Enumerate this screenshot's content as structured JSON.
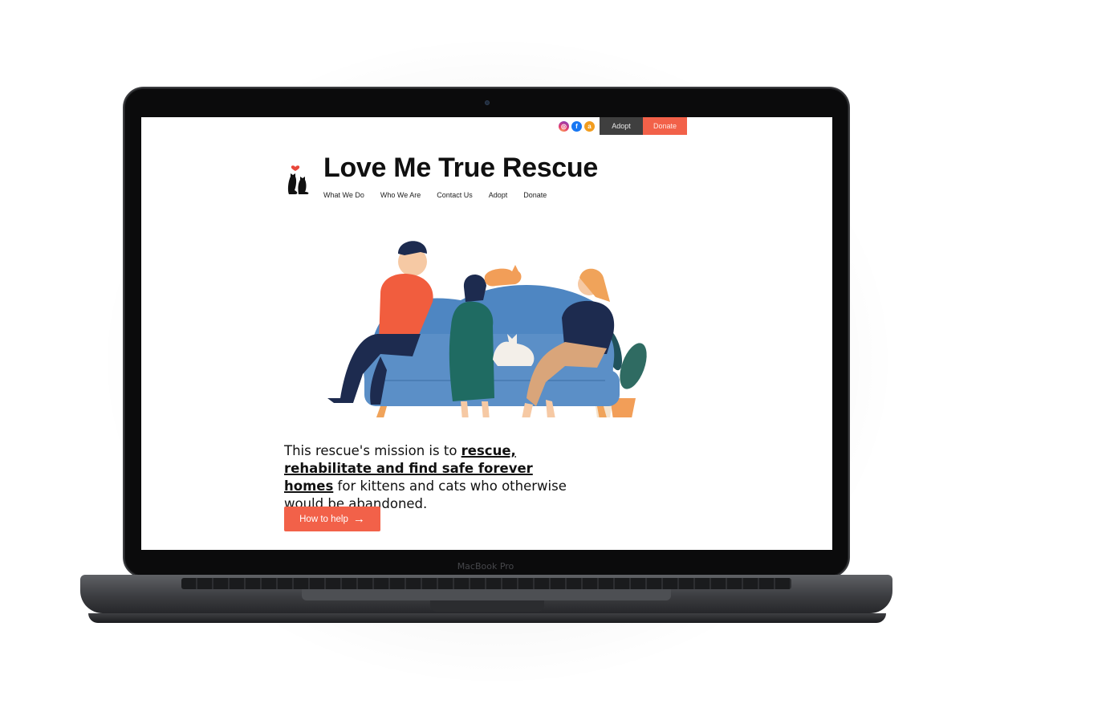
{
  "device": {
    "brand_label": "MacBook Pro"
  },
  "topbar": {
    "social_icons": [
      "instagram-icon",
      "facebook-icon",
      "amazon-icon"
    ],
    "adopt_label": "Adopt",
    "donate_label": "Donate"
  },
  "header": {
    "title": "Love Me True Rescue",
    "logo_icon": "cat-heart-logo",
    "nav": [
      "What We Do",
      "Who We Are",
      "Contact Us",
      "Adopt",
      "Donate"
    ]
  },
  "hero": {
    "illustration": "people-with-cats-on-sofa",
    "mission": {
      "prefix": "This rescue's mission is to ",
      "emphasis": "rescue, rehabilitate and find safe forever homes",
      "suffix": " for kittens and cats who otherwise would be abandoned."
    },
    "cta_label": "How to help"
  },
  "colors": {
    "accent": "#f26149",
    "dark_button": "#3f3f3f",
    "sofa": "#5b8fc7"
  }
}
